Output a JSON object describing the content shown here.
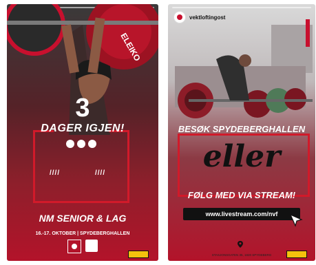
{
  "storyA": {
    "handle": "vektloftingost",
    "countdown_number": "3",
    "countdown_label": "DAGER IGJEN!",
    "slashes_left": "////",
    "slashes_right": "////",
    "event_title": "NM SENIOR & LAG",
    "date_venue": "16.-17. OKTOBER | SPYDEBERGHALLEN",
    "plate_brand": "ELEIKO"
  },
  "storyB": {
    "handle": "vektloftingost",
    "visit_text": "BESØK SPYDEBERGHALLEN",
    "or_text": "eller",
    "follow_text": "FØLG MED VIA STREAM!",
    "url": "www.livestream.com/nvf",
    "address": "STASJONSGATEN 35, 1820 SPYDEBERG"
  },
  "colors": {
    "brand_red": "#c8102e",
    "frame_red": "#d11a2a",
    "url_bar": "#111111"
  }
}
